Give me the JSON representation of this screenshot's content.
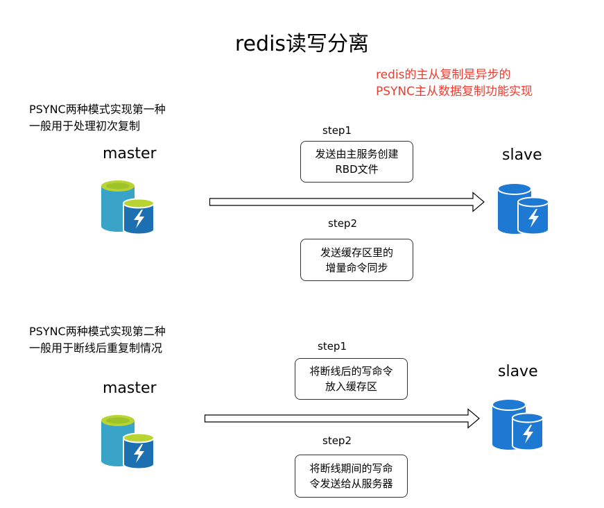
{
  "title": "redis读写分离",
  "note": {
    "color": "#f03a2e",
    "lines": [
      "redis的主从复制是异步的",
      "PSYNC主从数据复制功能实现"
    ]
  },
  "sections": [
    {
      "mode_lines": [
        "PSYNC两种模式实现第一种",
        "一般用于处理初次复制"
      ],
      "master_label": "master",
      "slave_label": "slave",
      "step1": {
        "label": "step1",
        "lines": [
          "发送由主服务创建",
          "RBD文件"
        ]
      },
      "step2": {
        "label": "step2",
        "lines": [
          "发送缓存区里的",
          "增量命令同步"
        ]
      }
    },
    {
      "mode_lines": [
        "PSYNC两种模式实现第二种",
        "一般用于断线后重复制情况"
      ],
      "master_label": "master",
      "slave_label": "slave",
      "step1": {
        "label": "step1",
        "lines": [
          "将断线后的写命令",
          "放入缓存区"
        ]
      },
      "step2": {
        "label": "step2",
        "lines": [
          "将断线期间的写命",
          "令发送给从服务器"
        ]
      }
    }
  ],
  "icons": {
    "master": "azure-sql-database-icon",
    "slave": "database-lightning-icon"
  },
  "colors": {
    "master_teal": "#3aa3c8",
    "master_lime": "#b8d432",
    "slave_blue": "#1e79d2"
  }
}
